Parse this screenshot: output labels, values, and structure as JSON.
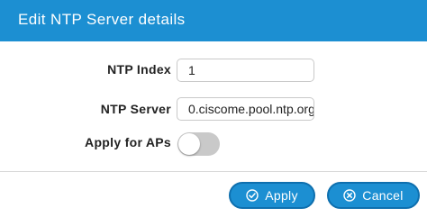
{
  "dialog": {
    "title": "Edit NTP Server details"
  },
  "form": {
    "ntp_index": {
      "label": "NTP Index",
      "value": "1"
    },
    "ntp_server": {
      "label": "NTP Server",
      "value": "0.ciscome.pool.ntp.org"
    },
    "apply_for_aps": {
      "label": "Apply for APs",
      "enabled": false
    }
  },
  "footer": {
    "apply_label": "Apply",
    "apply_icon": "check-circle-icon",
    "cancel_label": "Cancel",
    "cancel_icon": "x-circle-icon"
  },
  "colors": {
    "header": "#1c8fd2",
    "button": "#1c8fd2",
    "toggle_off": "#c9c9c9"
  }
}
